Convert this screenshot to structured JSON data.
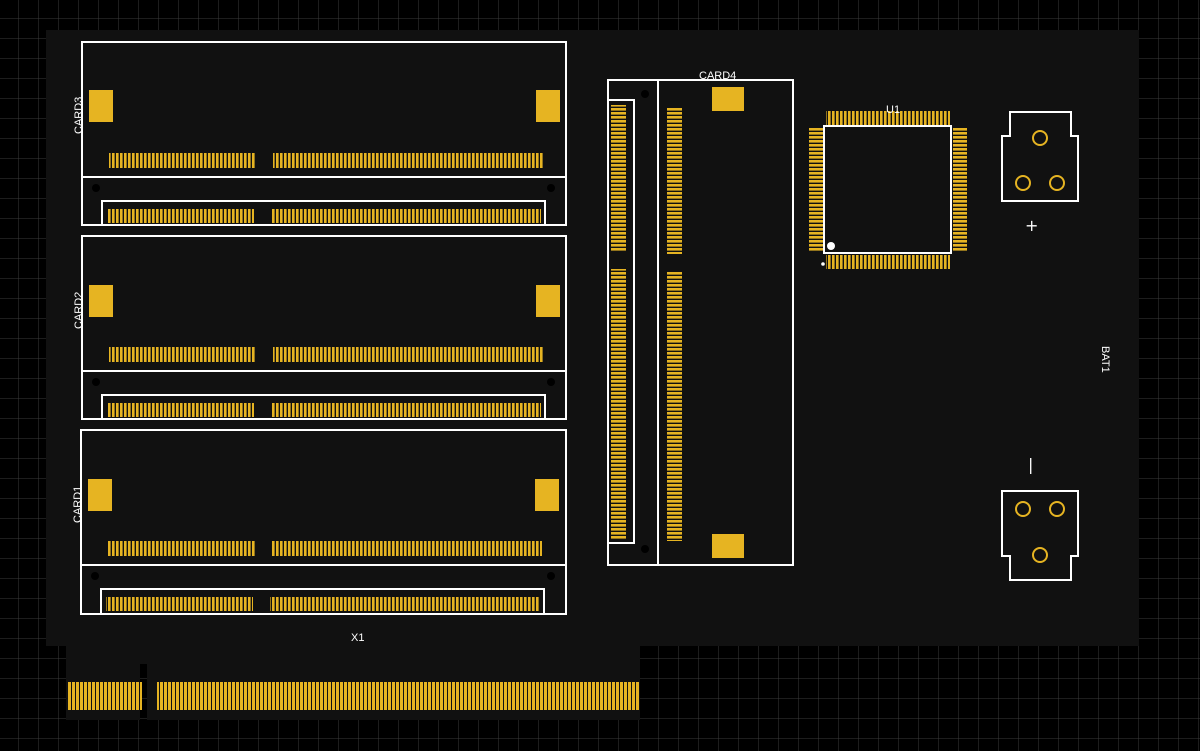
{
  "colors": {
    "background": "#000000",
    "grid": "#3a3a3a",
    "board": "#111111",
    "silkscreen": "#ffffff",
    "pad": "#e6b422"
  },
  "labels": {
    "card1": "CARD1",
    "card2": "CARD2",
    "card3": "CARD3",
    "card4": "CARD4",
    "u1": "U1",
    "x1": "X1",
    "bat1": "BAT1",
    "plus": "+",
    "minus": "|"
  }
}
